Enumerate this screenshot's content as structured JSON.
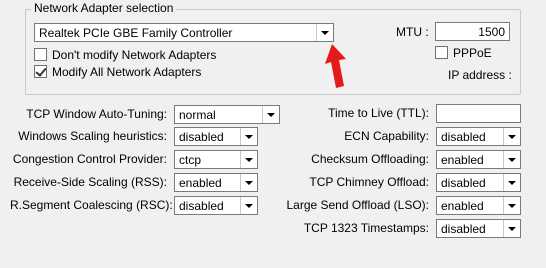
{
  "adapter_group": {
    "title": "Network Adapter selection",
    "adapter_select": "Realtek PCIe GBE Family Controller",
    "mtu_label": "MTU :",
    "mtu_value": "1500",
    "dont_modify_label": "Don't modify Network Adapters",
    "dont_modify_checked": false,
    "modify_all_label": "Modify All Network Adapters",
    "modify_all_checked": true,
    "pppoe_label": "PPPoE",
    "pppoe_checked": false,
    "ip_label": "IP address :"
  },
  "left_settings": [
    {
      "label": "TCP Window Auto-Tuning:",
      "value": "normal"
    },
    {
      "label": "Windows Scaling heuristics:",
      "value": "disabled"
    },
    {
      "label": "Congestion Control Provider:",
      "value": "ctcp"
    },
    {
      "label": "Receive-Side Scaling (RSS):",
      "value": "enabled"
    },
    {
      "label": "R.Segment Coalescing (RSC):",
      "value": "disabled"
    }
  ],
  "right_settings": [
    {
      "label": "Time to Live (TTL):",
      "value": ""
    },
    {
      "label": "ECN Capability:",
      "value": "disabled"
    },
    {
      "label": "Checksum Offloading:",
      "value": "enabled"
    },
    {
      "label": "TCP Chimney Offload:",
      "value": "disabled"
    },
    {
      "label": "Large Send Offload (LSO):",
      "value": "enabled"
    },
    {
      "label": "TCP 1323 Timestamps:",
      "value": "disabled"
    }
  ],
  "colors": {
    "background": "#f0f0f0",
    "arrow": "#e51a1a"
  },
  "icons": {
    "annotation": "red-arrow-icon"
  }
}
